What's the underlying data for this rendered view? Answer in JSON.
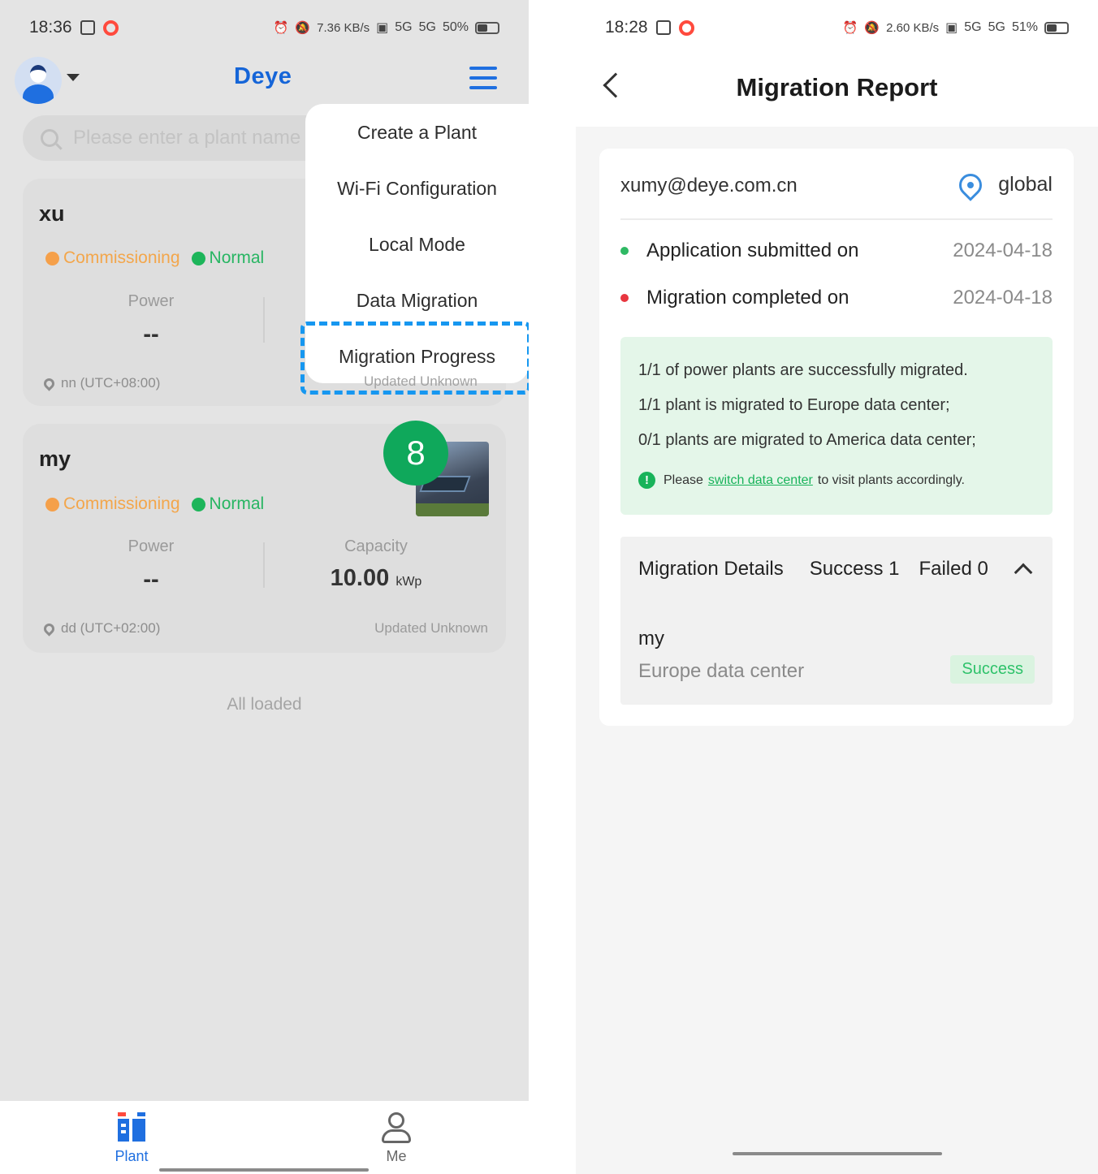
{
  "left": {
    "status": {
      "time": "18:36",
      "speed": "7.36 KB/s",
      "net1": "5G",
      "net2": "5G",
      "battery": "50%",
      "battery_level": 0.5
    },
    "header": {
      "logo": "Deye"
    },
    "search": {
      "placeholder": "Please enter a plant name"
    },
    "menu": {
      "items": [
        "Create a Plant",
        "Wi-Fi Configuration",
        "Local Mode",
        "Data Migration",
        "Migration Progress"
      ],
      "highlighted": "Migration Progress",
      "covered_text": "Updated Unknown"
    },
    "plants": [
      {
        "name": "xu",
        "status1": "Commissioning",
        "status2": "Normal",
        "power_label": "Power",
        "power_value": "--",
        "location": "nn (UTC+08:00)"
      },
      {
        "name": "my",
        "status1": "Commissioning",
        "status2": "Normal",
        "power_label": "Power",
        "power_value": "--",
        "capacity_label": "Capacity",
        "capacity_value": "10.00",
        "capacity_unit": "kWp",
        "location": "dd (UTC+02:00)",
        "updated_label": "Updated",
        "updated_value": "Unknown"
      }
    ],
    "step_badge": "8",
    "footer_text": "All loaded",
    "tabbar": {
      "plant": "Plant",
      "me": "Me"
    },
    "colors": {
      "accent": "#1f6fe0",
      "highlight": "#1697f0",
      "badge": "#0fa85b",
      "commissioning": "#f3a64b",
      "normal": "#27b562"
    }
  },
  "right": {
    "status": {
      "time": "18:28",
      "speed": "2.60 KB/s",
      "net1": "5G",
      "net2": "5G",
      "battery": "51%",
      "battery_level": 0.51
    },
    "nav": {
      "title": "Migration Report"
    },
    "account": "xumy@deye.com.cn",
    "region": "global",
    "timeline": [
      {
        "label": "Application submitted on",
        "date": "2024-04-18",
        "color": "#2fb964"
      },
      {
        "label": "Migration completed on",
        "date": "2024-04-18",
        "color": "#e8363f"
      }
    ],
    "summary": {
      "line1": "1/1 of power plants are successfully migrated.",
      "line2": "1/1 plant is migrated to Europe data center;",
      "line3": "0/1 plants are migrated to America data center;",
      "note_prefix": "Please",
      "note_link": "switch data center",
      "note_suffix": "to visit plants accordingly."
    },
    "details": {
      "title": "Migration Details",
      "success": "Success 1",
      "failed": "Failed 0",
      "item_name": "my",
      "item_dc": "Europe data center",
      "item_status": "Success"
    }
  }
}
